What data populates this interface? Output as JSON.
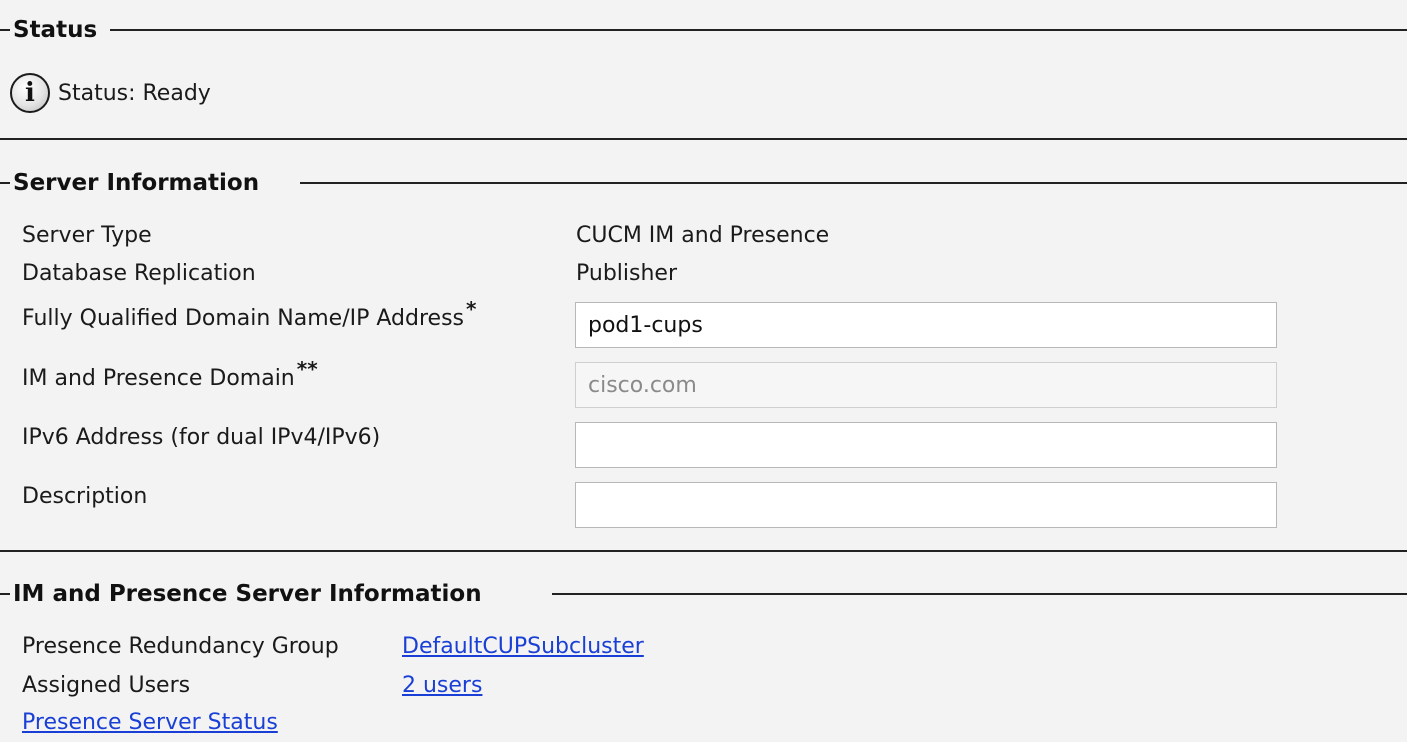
{
  "status_section": {
    "title": "Status",
    "status_text": "Status: Ready",
    "icon": "info-icon"
  },
  "server_info": {
    "title": "Server Information",
    "rows": {
      "server_type": {
        "label": "Server Type",
        "value": "CUCM IM and Presence"
      },
      "db_replication": {
        "label": "Database Replication",
        "value": "Publisher"
      },
      "fqdn": {
        "label": "Fully Qualified Domain Name/IP Address",
        "marker": "*",
        "value": "pod1-cups"
      },
      "im_domain": {
        "label": "IM and Presence Domain",
        "marker": "**",
        "value": "cisco.com"
      },
      "ipv6": {
        "label": "IPv6 Address (for dual IPv4/IPv6)",
        "value": ""
      },
      "description": {
        "label": "Description",
        "value": ""
      }
    }
  },
  "imp_info": {
    "title": "IM and Presence Server Information",
    "redundancy_group": {
      "label": "Presence Redundancy Group",
      "link": "DefaultCUPSubcluster"
    },
    "assigned_users": {
      "label": "Assigned Users",
      "link": "2 users"
    },
    "server_status_link": "Presence Server Status"
  },
  "colors": {
    "background": "#f3f3f3",
    "link": "#1a3fd6",
    "rule": "#222222"
  }
}
